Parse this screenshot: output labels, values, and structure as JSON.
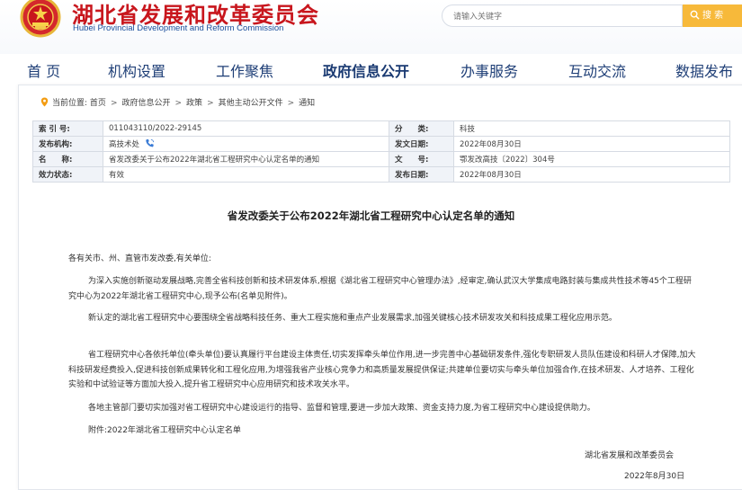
{
  "header": {
    "title_cn": "湖北省发展和改革委员会",
    "title_en": "Hubei Provincial Development and Reform Commission",
    "search_placeholder": "请输入关键字",
    "search_button": "搜 索",
    "colors": {
      "brand_red": "#c8161d",
      "accent_blue": "#1c4f9c",
      "search_btn": "#f7b93a"
    }
  },
  "nav": {
    "items": [
      {
        "label": "首 页"
      },
      {
        "label": "机构设置"
      },
      {
        "label": "工作聚焦"
      },
      {
        "label": "政府信息公开",
        "active": true
      },
      {
        "label": "办事服务"
      },
      {
        "label": "互动交流"
      },
      {
        "label": "数据发布"
      }
    ]
  },
  "breadcrumb": {
    "prefix": "当前位置:",
    "items": [
      "首页",
      "政府信息公开",
      "政策",
      "其他主动公开文件",
      "通知"
    ],
    "separator": ">"
  },
  "meta": {
    "rows": [
      {
        "k1": "索 引 号:",
        "v1": "011043110/2022-29145",
        "k2": "分　　类:",
        "v2": "科技"
      },
      {
        "k1": "发布机构:",
        "v1": "高技术处",
        "k2": "发文日期:",
        "v2": "2022年08月30日"
      },
      {
        "k1": "名　　称:",
        "v1": "省发改委关于公布2022年湖北省工程研究中心认定名单的通知",
        "k2": "文　　号:",
        "v2": "鄂发改高技〔2022〕304号"
      },
      {
        "k1": "效力状态:",
        "v1": "有效",
        "k2": "发布日期:",
        "v2": "2022年08月30日"
      }
    ]
  },
  "article": {
    "title": "省发改委关于公布2022年湖北省工程研究中心认定名单的通知",
    "salutation": "各有关市、州、直管市发改委,有关单位:",
    "paragraphs": [
      "为深入实施创新驱动发展战略,完善全省科技创新和技术研发体系,根据《湖北省工程研究中心管理办法》,经审定,确认武汉大学集成电路封装与集成共性技术等45个工程研究中心为2022年湖北省工程研究中心,现予公布(名单见附件)。",
      "新认定的湖北省工程研究中心要围绕全省战略科技任务、重大工程实施和重点产业发展需求,加强关键核心技术研发攻关和科技成果工程化应用示范。",
      "省工程研究中心各依托单位(牵头单位)要认真履行平台建设主体责任,切实发挥牵头单位作用,进一步完善中心基础研发条件,强化专职研发人员队伍建设和科研人才保障,加大科技研发经费投入,促进科技创新成果转化和工程化应用,为增强我省产业核心竞争力和高质量发展提供保证;共建单位要切实与牵头单位加强合作,在技术研发、人才培养、工程化实验和中试验证等方面加大投入,提升省工程研究中心应用研究和技术攻关水平。",
      "各地主管部门要切实加强对省工程研究中心建设运行的指导、监督和管理,要进一步加大政策、资金支持力度,为省工程研究中心建设提供助力。",
      "附件:2022年湖北省工程研究中心认定名单"
    ],
    "signer": "湖北省发展和改革委员会",
    "date": "2022年8月30日"
  }
}
